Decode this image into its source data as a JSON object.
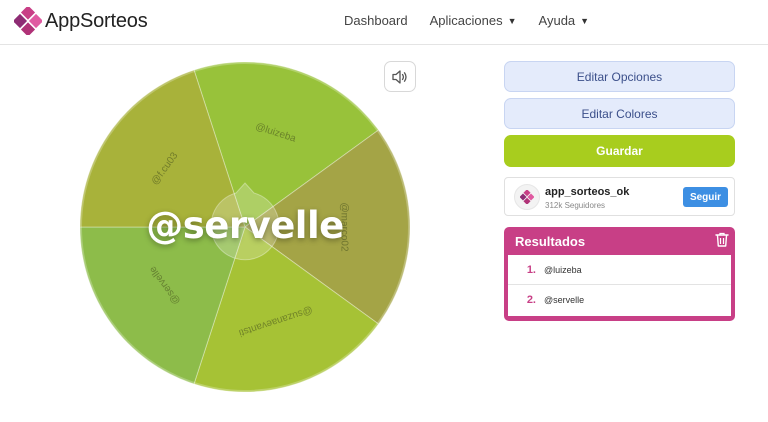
{
  "header": {
    "logo_text": "AppSorteos",
    "nav": [
      {
        "label": "Dashboard",
        "has_dropdown": false
      },
      {
        "label": "Aplicaciones",
        "has_dropdown": true
      },
      {
        "label": "Ayuda",
        "has_dropdown": true
      }
    ]
  },
  "wheel": {
    "winner": "@servelle",
    "segments": [
      {
        "label": "@luizeba",
        "color": "#98c23a"
      },
      {
        "label": "@marco02",
        "color": "#a4a446"
      },
      {
        "label": "@suzanaevantsti",
        "color": "#a6c235"
      },
      {
        "label": "@servelle",
        "color": "#8dbc4a"
      },
      {
        "label": "@f.cu03",
        "color": "#a8b23a"
      }
    ]
  },
  "panel": {
    "edit_options_label": "Editar Opciones",
    "edit_colors_label": "Editar Colores",
    "save_label": "Guardar",
    "account": {
      "name": "app_sorteos_ok",
      "followers": "312k Seguidores",
      "follow_label": "Seguir"
    },
    "results": {
      "title": "Resultados",
      "items": [
        {
          "num": "1.",
          "value": "@luizeba"
        },
        {
          "num": "2.",
          "value": "@servelle"
        }
      ]
    }
  },
  "colors": {
    "accent_pink": "#c83f86",
    "save_green": "#a8cd1e",
    "follow_blue": "#3d8fe3"
  }
}
